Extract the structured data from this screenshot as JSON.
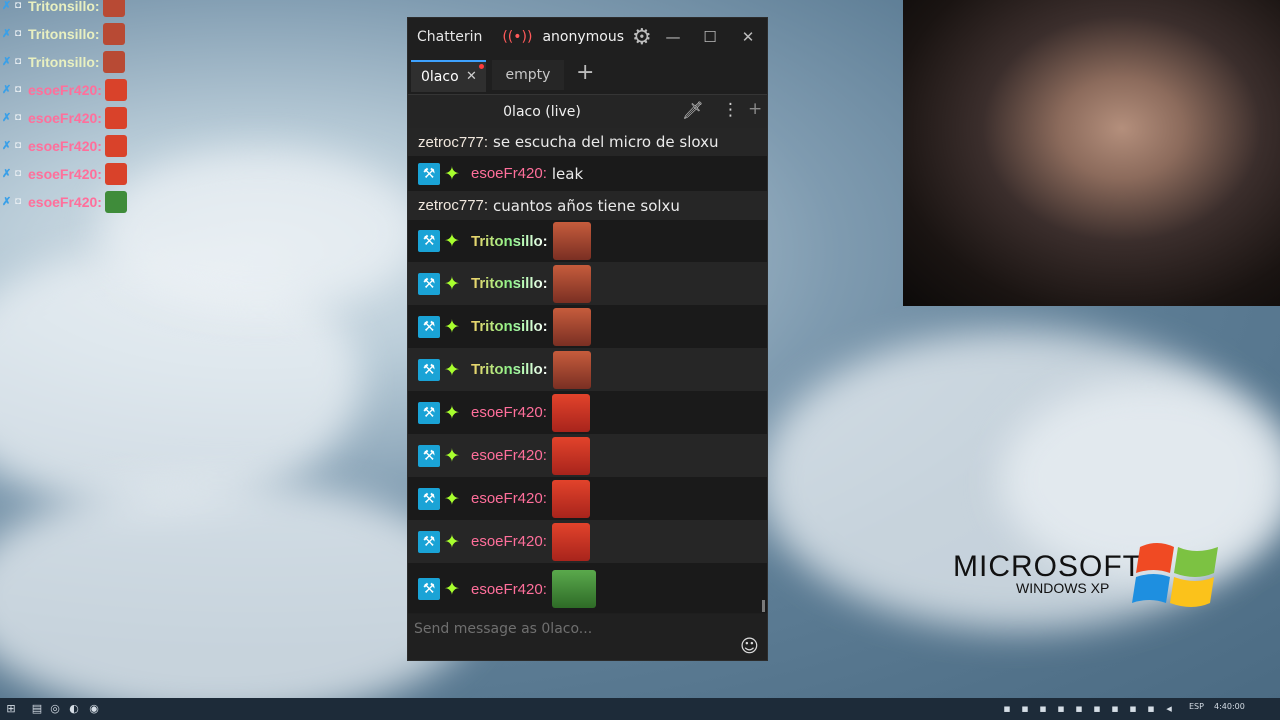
{
  "overlay": {
    "rows": [
      {
        "user": "Tritonsillo:",
        "color": "#f0d26a"
      },
      {
        "user": "Tritonsillo:",
        "color": "#f0d26a"
      },
      {
        "user": "Tritonsillo:",
        "color": "#f0d26a"
      },
      {
        "user": "esoeFr420:",
        "color": "#ff6f9b"
      },
      {
        "user": "esoeFr420:",
        "color": "#ff6f9b"
      },
      {
        "user": "esoeFr420:",
        "color": "#ff6f9b"
      },
      {
        "user": "esoeFr420:",
        "color": "#ff6f9b"
      },
      {
        "user": "esoeFr420:",
        "color": "#ff6f9b"
      }
    ]
  },
  "window": {
    "title": "Chatterin",
    "account": "anonymous",
    "live_icon": "broadcast-icon",
    "settings_icon": "gear-icon"
  },
  "tabs": [
    {
      "label": "0laco",
      "active": true
    },
    {
      "label": "empty",
      "active": false
    }
  ],
  "split": {
    "channel": "0laco (live)"
  },
  "messages": [
    {
      "user": "zetroc777:",
      "text": "se escucha del micro de sloxu",
      "badges": false,
      "emote": null,
      "style": "zetroc"
    },
    {
      "user": "esoeFr420:",
      "text": "leak",
      "badges": true,
      "emote": null,
      "style": "esoe"
    },
    {
      "user": "zetroc777:",
      "text": "cuantos años tiene solxu",
      "badges": false,
      "emote": null,
      "style": "zetroc"
    },
    {
      "user": "Tritonsillo:",
      "text": "",
      "badges": true,
      "emote": "kappa",
      "style": "triton"
    },
    {
      "user": "Tritonsillo:",
      "text": "",
      "badges": true,
      "emote": "kappa",
      "style": "triton"
    },
    {
      "user": "Tritonsillo:",
      "text": "",
      "badges": true,
      "emote": "kappa",
      "style": "triton"
    },
    {
      "user": "Tritonsillo:",
      "text": "",
      "badges": true,
      "emote": "kappa",
      "style": "triton"
    },
    {
      "user": "esoeFr420:",
      "text": "",
      "badges": true,
      "emote": "red",
      "style": "esoe"
    },
    {
      "user": "esoeFr420:",
      "text": "",
      "badges": true,
      "emote": "red",
      "style": "esoe"
    },
    {
      "user": "esoeFr420:",
      "text": "",
      "badges": true,
      "emote": "red",
      "style": "esoe"
    },
    {
      "user": "esoeFr420:",
      "text": "",
      "badges": true,
      "emote": "red",
      "style": "esoe"
    },
    {
      "user": "esoeFr420:",
      "text": "",
      "badges": true,
      "emote": "pepe",
      "style": "esoe"
    }
  ],
  "input": {
    "placeholder": "Send message as 0laco..."
  },
  "branding": {
    "line1": "MICROSOFT",
    "line2": "WINDOWS XP"
  },
  "taskbar": {
    "language": "ESP",
    "clock": "4:40:00"
  }
}
